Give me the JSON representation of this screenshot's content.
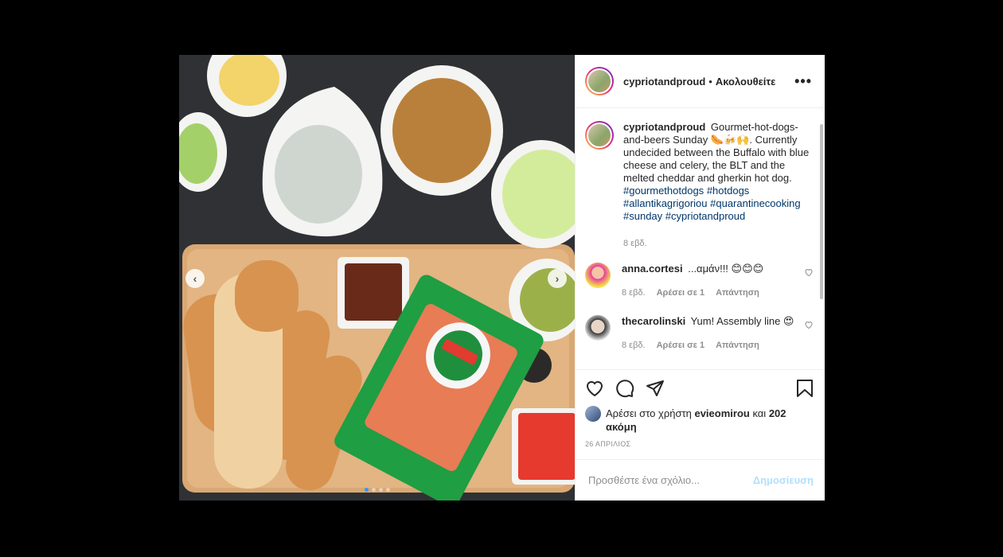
{
  "post": {
    "username": "cypriotandproud",
    "separator": "•",
    "follow_label": "Ακολουθείτε",
    "more_label": "•••",
    "caption_user": "cypriotandproud",
    "caption_text": "Gourmet-hot-dogs-and-beers Sunday 🌭🍻🙌. Currently undecided between the Buffalo with blue cheese and celery, the BLT and the melted cheddar and gherkin hot dog.",
    "hashtags": [
      "#gourmethotdogs",
      "#hotdogs",
      "#allantikagrigoriou",
      "#quarantinecooking",
      "#sunday",
      "#cypriotandproud"
    ],
    "caption_age": "8 εβδ.",
    "comments": [
      {
        "user": "anna.cortesi",
        "text": "...αμάν!!! 😊😊😊",
        "age": "8 εβδ.",
        "likes": "Αρέσει σε 1",
        "reply": "Απάντηση"
      },
      {
        "user": "thecarolinski",
        "text": "Yum! Assembly line 😍",
        "age": "8 εβδ.",
        "likes": "Αρέσει σε 1",
        "reply": "Απάντηση"
      }
    ],
    "likes_prefix": "Αρέσει στο χρήστη",
    "likes_user": "evieomirou",
    "likes_suffix": "και",
    "likes_more": "202 ακόμη",
    "date": "26 ΑΠΡΙΛΙΟΣ",
    "comment_placeholder": "Προσθέστε ένα σχόλιο...",
    "post_button": "Δημοσίευση"
  },
  "nav": {
    "prev": "‹",
    "next": "›"
  },
  "carousel": {
    "count": 4,
    "active": 1
  },
  "colors": {
    "accent": "#3897f0",
    "link": "#00376b",
    "muted": "#8e8e8e",
    "post_disabled": "#b2dffc"
  },
  "icons": [
    "heart-icon",
    "comment-icon",
    "share-icon",
    "bookmark-icon",
    "more-icon"
  ]
}
